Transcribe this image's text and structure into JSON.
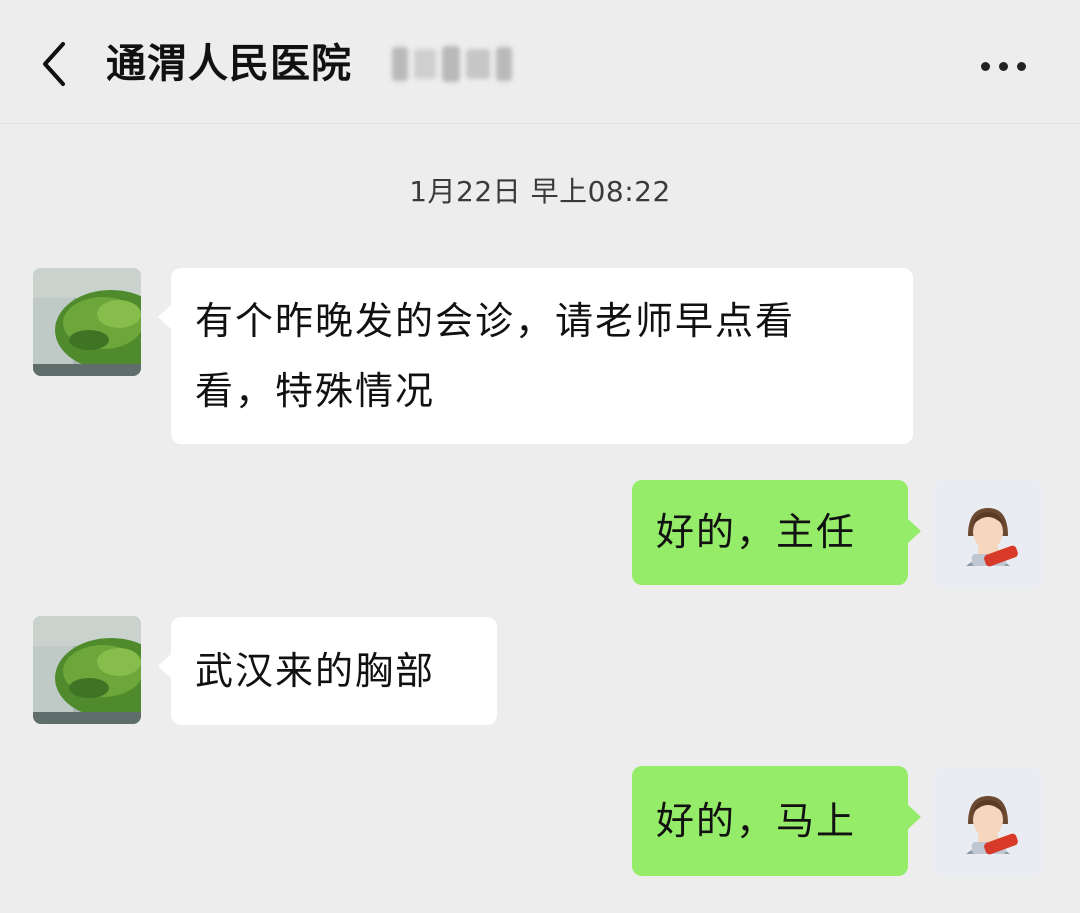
{
  "header": {
    "title": "通渭人民医院",
    "back_icon": "chevron-left-icon",
    "more_icon": "more-horizontal-icon"
  },
  "timestamp": "1月22日 早上08:22",
  "messages": [
    {
      "side": "left",
      "lines": [
        "有个昨晚发的会诊，请老师早点看",
        "看，特殊情况"
      ]
    },
    {
      "side": "right",
      "lines": [
        "好的，主任"
      ]
    },
    {
      "side": "left",
      "lines": [
        "武汉来的胸部"
      ]
    },
    {
      "side": "right",
      "lines": [
        "好的，马上"
      ]
    }
  ],
  "colors": {
    "background": "#ededed",
    "incoming_bubble": "#ffffff",
    "outgoing_bubble": "#95ec69"
  }
}
